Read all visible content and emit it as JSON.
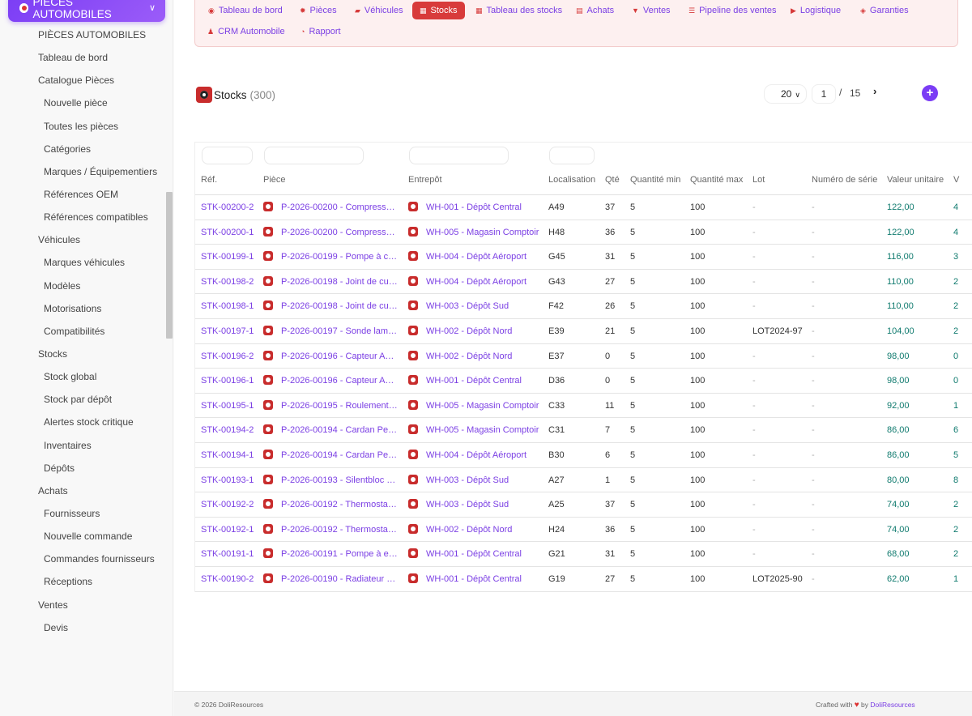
{
  "module": {
    "title": "PIÈCES AUTOMOBILES"
  },
  "sidebar": {
    "items": [
      {
        "label": "PIÈCES AUTOMOBILES",
        "level": 1
      },
      {
        "label": "Tableau de bord",
        "level": 1
      },
      {
        "label": "Catalogue Pièces",
        "level": 1
      },
      {
        "label": "Nouvelle pièce",
        "level": 2
      },
      {
        "label": "Toutes les pièces",
        "level": 2
      },
      {
        "label": "Catégories",
        "level": 2
      },
      {
        "label": "Marques / Équipementiers",
        "level": 2
      },
      {
        "label": "Références OEM",
        "level": 2
      },
      {
        "label": "Références compatibles",
        "level": 2
      },
      {
        "label": "Véhicules",
        "level": 1
      },
      {
        "label": "Marques véhicules",
        "level": 2
      },
      {
        "label": "Modèles",
        "level": 2
      },
      {
        "label": "Motorisations",
        "level": 2
      },
      {
        "label": "Compatibilités",
        "level": 2
      },
      {
        "label": "Stocks",
        "level": 1
      },
      {
        "label": "Stock global",
        "level": 2
      },
      {
        "label": "Stock par dépôt",
        "level": 2
      },
      {
        "label": "Alertes stock critique",
        "level": 2
      },
      {
        "label": "Inventaires",
        "level": 2
      },
      {
        "label": "Dépôts",
        "level": 2
      },
      {
        "label": "Achats",
        "level": 1
      },
      {
        "label": "Fournisseurs",
        "level": 2
      },
      {
        "label": "Nouvelle commande",
        "level": 2
      },
      {
        "label": "Commandes fournisseurs",
        "level": 2
      },
      {
        "label": "Réceptions",
        "level": 2
      },
      {
        "label": "Ventes",
        "level": 1
      },
      {
        "label": "Devis",
        "level": 2
      }
    ]
  },
  "topnav": {
    "items": [
      {
        "label": "Tableau de bord",
        "icon": "gauge-icon",
        "glyph": "◉",
        "active": false
      },
      {
        "label": "Pièces",
        "icon": "gear-icon",
        "glyph": "✹",
        "active": false
      },
      {
        "label": "Véhicules",
        "icon": "car-icon",
        "glyph": "▰",
        "active": false
      },
      {
        "label": "Stocks",
        "icon": "boxes-icon",
        "glyph": "▦",
        "active": true
      },
      {
        "label": "Tableau des stocks",
        "icon": "grid-icon",
        "glyph": "▦",
        "active": false
      },
      {
        "label": "Achats",
        "icon": "invoice-icon",
        "glyph": "▤",
        "active": false
      },
      {
        "label": "Ventes",
        "icon": "cart-icon",
        "glyph": "▼",
        "active": false
      },
      {
        "label": "Pipeline des ventes",
        "icon": "list-icon",
        "glyph": "☰",
        "active": false
      },
      {
        "label": "Logistique",
        "icon": "truck-icon",
        "glyph": "▶",
        "active": false
      },
      {
        "label": "Garanties",
        "icon": "shield-icon",
        "glyph": "◈",
        "active": false
      },
      {
        "label": "CRM Automobile",
        "icon": "user-plus-icon",
        "glyph": "♟",
        "active": false
      },
      {
        "label": "Rapport",
        "icon": "pie-chart-icon",
        "glyph": "◔",
        "active": false
      }
    ]
  },
  "page": {
    "title": "Stocks",
    "count": "(300)"
  },
  "pagination": {
    "per_page": "20",
    "current": "1",
    "separator": "/",
    "total": "15",
    "next": "›",
    "add": "+"
  },
  "table": {
    "columns": [
      "Réf.",
      "Pièce",
      "Entrepôt",
      "Localisation",
      "Qté",
      "Quantité min",
      "Quantité max",
      "Lot",
      "Numéro de série",
      "Valeur unitaire",
      "V"
    ],
    "rows": [
      {
        "ref": "STK-00200-2",
        "piece": "P-2026-00200 - Compress…",
        "entrepot": "WH-001 - Dépôt Central",
        "loc": "A49",
        "qte": "37",
        "min": "5",
        "max": "100",
        "lot": "-",
        "serie": "-",
        "valeur": "122,00",
        "v": "4"
      },
      {
        "ref": "STK-00200-1",
        "piece": "P-2026-00200 - Compress…",
        "entrepot": "WH-005 - Magasin Comptoir",
        "loc": "H48",
        "qte": "36",
        "min": "5",
        "max": "100",
        "lot": "-",
        "serie": "-",
        "valeur": "122,00",
        "v": "4"
      },
      {
        "ref": "STK-00199-1",
        "piece": "P-2026-00199 - Pompe à c…",
        "entrepot": "WH-004 - Dépôt Aéroport",
        "loc": "G45",
        "qte": "31",
        "min": "5",
        "max": "100",
        "lot": "-",
        "serie": "-",
        "valeur": "116,00",
        "v": "3"
      },
      {
        "ref": "STK-00198-2",
        "piece": "P-2026-00198 - Joint de cu…",
        "entrepot": "WH-004 - Dépôt Aéroport",
        "loc": "G43",
        "qte": "27",
        "min": "5",
        "max": "100",
        "lot": "-",
        "serie": "-",
        "valeur": "110,00",
        "v": "2"
      },
      {
        "ref": "STK-00198-1",
        "piece": "P-2026-00198 - Joint de cu…",
        "entrepot": "WH-003 - Dépôt Sud",
        "loc": "F42",
        "qte": "26",
        "min": "5",
        "max": "100",
        "lot": "-",
        "serie": "-",
        "valeur": "110,00",
        "v": "2"
      },
      {
        "ref": "STK-00197-1",
        "piece": "P-2026-00197 - Sonde lam…",
        "entrepot": "WH-002 - Dépôt Nord",
        "loc": "E39",
        "qte": "21",
        "min": "5",
        "max": "100",
        "lot": "LOT2024-97",
        "serie": "-",
        "valeur": "104,00",
        "v": "2"
      },
      {
        "ref": "STK-00196-2",
        "piece": "P-2026-00196 - Capteur A…",
        "entrepot": "WH-002 - Dépôt Nord",
        "loc": "E37",
        "qte": "0",
        "min": "5",
        "max": "100",
        "lot": "-",
        "serie": "-",
        "valeur": "98,00",
        "v": "0"
      },
      {
        "ref": "STK-00196-1",
        "piece": "P-2026-00196 - Capteur A…",
        "entrepot": "WH-001 - Dépôt Central",
        "loc": "D36",
        "qte": "0",
        "min": "5",
        "max": "100",
        "lot": "-",
        "serie": "-",
        "valeur": "98,00",
        "v": "0"
      },
      {
        "ref": "STK-00195-1",
        "piece": "P-2026-00195 - Roulement…",
        "entrepot": "WH-005 - Magasin Comptoir",
        "loc": "C33",
        "qte": "11",
        "min": "5",
        "max": "100",
        "lot": "-",
        "serie": "-",
        "valeur": "92,00",
        "v": "1"
      },
      {
        "ref": "STK-00194-2",
        "piece": "P-2026-00194 - Cardan Pe…",
        "entrepot": "WH-005 - Magasin Comptoir",
        "loc": "C31",
        "qte": "7",
        "min": "5",
        "max": "100",
        "lot": "-",
        "serie": "-",
        "valeur": "86,00",
        "v": "6"
      },
      {
        "ref": "STK-00194-1",
        "piece": "P-2026-00194 - Cardan Pe…",
        "entrepot": "WH-004 - Dépôt Aéroport",
        "loc": "B30",
        "qte": "6",
        "min": "5",
        "max": "100",
        "lot": "-",
        "serie": "-",
        "valeur": "86,00",
        "v": "5"
      },
      {
        "ref": "STK-00193-1",
        "piece": "P-2026-00193 - Silentbloc …",
        "entrepot": "WH-003 - Dépôt Sud",
        "loc": "A27",
        "qte": "1",
        "min": "5",
        "max": "100",
        "lot": "-",
        "serie": "-",
        "valeur": "80,00",
        "v": "8"
      },
      {
        "ref": "STK-00192-2",
        "piece": "P-2026-00192 - Thermosta…",
        "entrepot": "WH-003 - Dépôt Sud",
        "loc": "A25",
        "qte": "37",
        "min": "5",
        "max": "100",
        "lot": "-",
        "serie": "-",
        "valeur": "74,00",
        "v": "2"
      },
      {
        "ref": "STK-00192-1",
        "piece": "P-2026-00192 - Thermosta…",
        "entrepot": "WH-002 - Dépôt Nord",
        "loc": "H24",
        "qte": "36",
        "min": "5",
        "max": "100",
        "lot": "-",
        "serie": "-",
        "valeur": "74,00",
        "v": "2"
      },
      {
        "ref": "STK-00191-1",
        "piece": "P-2026-00191 - Pompe à e…",
        "entrepot": "WH-001 - Dépôt Central",
        "loc": "G21",
        "qte": "31",
        "min": "5",
        "max": "100",
        "lot": "-",
        "serie": "-",
        "valeur": "68,00",
        "v": "2"
      },
      {
        "ref": "STK-00190-2",
        "piece": "P-2026-00190 - Radiateur …",
        "entrepot": "WH-001 - Dépôt Central",
        "loc": "G19",
        "qte": "27",
        "min": "5",
        "max": "100",
        "lot": "LOT2025-90",
        "serie": "-",
        "valeur": "62,00",
        "v": "1"
      }
    ]
  },
  "footer": {
    "copyright": "© 2026 DoliResources",
    "crafted": "Crafted with",
    "heart": "♥",
    "by": "by",
    "brand": "DoliResources"
  },
  "colors": {
    "accent": "#7b3df5",
    "link": "#7b3fe4",
    "active_tab": "#d83b3b",
    "value": "#0f7a6e"
  }
}
